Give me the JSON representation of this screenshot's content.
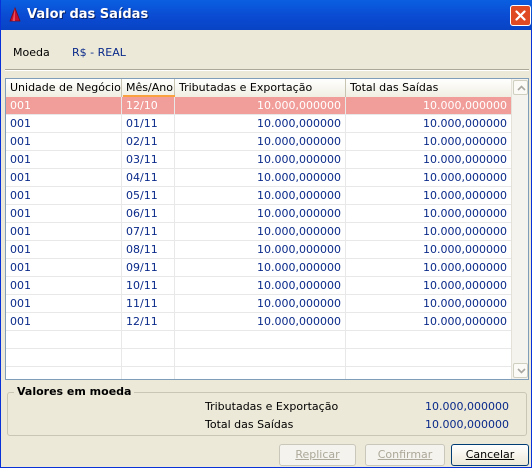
{
  "window": {
    "title": "Valor das Saídas"
  },
  "currency": {
    "label": "Moeda",
    "value": "R$ - REAL"
  },
  "table": {
    "columns": [
      "Unidade de Negócio",
      "Mês/Ano",
      "Tributadas e Exportação",
      "Total das Saídas"
    ],
    "rows": [
      [
        "001",
        "12/10",
        "10.000,000000",
        "10.000,000000"
      ],
      [
        "001",
        "01/11",
        "10.000,000000",
        "10.000,000000"
      ],
      [
        "001",
        "02/11",
        "10.000,000000",
        "10.000,000000"
      ],
      [
        "001",
        "03/11",
        "10.000,000000",
        "10.000,000000"
      ],
      [
        "001",
        "04/11",
        "10.000,000000",
        "10.000,000000"
      ],
      [
        "001",
        "05/11",
        "10.000,000000",
        "10.000,000000"
      ],
      [
        "001",
        "06/11",
        "10.000,000000",
        "10.000,000000"
      ],
      [
        "001",
        "07/11",
        "10.000,000000",
        "10.000,000000"
      ],
      [
        "001",
        "08/11",
        "10.000,000000",
        "10.000,000000"
      ],
      [
        "001",
        "09/11",
        "10.000,000000",
        "10.000,000000"
      ],
      [
        "001",
        "10/11",
        "10.000,000000",
        "10.000,000000"
      ],
      [
        "001",
        "11/11",
        "10.000,000000",
        "10.000,000000"
      ],
      [
        "001",
        "12/11",
        "10.000,000000",
        "10.000,000000"
      ],
      [
        "",
        "",
        "",
        ""
      ],
      [
        "",
        "",
        "",
        ""
      ],
      [
        "",
        "",
        "",
        ""
      ]
    ],
    "selected_row": 0
  },
  "values": {
    "title": "Valores em moeda",
    "tributadas_label": "Tributadas e Exportação",
    "tributadas_value": "10.000,000000",
    "total_label": "Total das Saídas",
    "total_value": "10.000,000000"
  },
  "buttons": {
    "replicar": "Replicar",
    "confirmar": "Confirmar",
    "cancelar": "Cancelar"
  },
  "colors": {
    "selected_row": "#f19d99",
    "value_text": "#0a2a8a",
    "title_bar": "#0a4bd2"
  }
}
